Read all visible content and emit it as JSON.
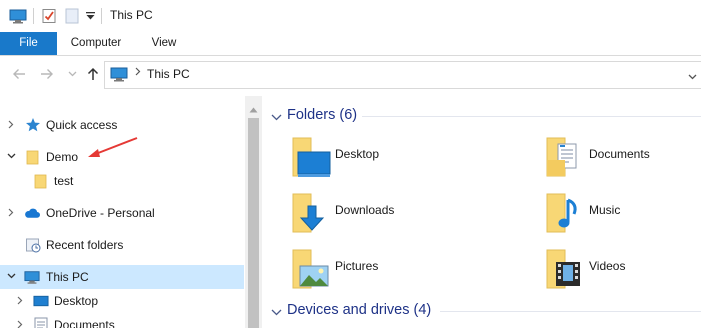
{
  "window": {
    "title": "This PC"
  },
  "ribbon": {
    "tabs": [
      {
        "label": "File"
      },
      {
        "label": "Computer"
      },
      {
        "label": "View"
      }
    ]
  },
  "address": {
    "path": "This PC"
  },
  "nav": {
    "items": [
      {
        "label": "Quick access",
        "icon": "star-pin-icon"
      },
      {
        "label": "Demo",
        "icon": "folder-icon",
        "expanded": true
      },
      {
        "label": "test",
        "icon": "folder-icon"
      },
      {
        "label": "OneDrive - Personal",
        "icon": "cloud-icon"
      },
      {
        "label": "Recent folders",
        "icon": "recent-folders-icon"
      },
      {
        "label": "This PC",
        "icon": "pc-icon",
        "selected": true
      },
      {
        "label": "Desktop",
        "icon": "desktop-folder-icon"
      },
      {
        "label": "Documents",
        "icon": "documents-folder-icon"
      }
    ]
  },
  "content": {
    "folders_header": "Folders (6)",
    "folders": [
      {
        "label": "Desktop",
        "icon": "desktop-folder-icon"
      },
      {
        "label": "Documents",
        "icon": "documents-folder-icon"
      },
      {
        "label": "Downloads",
        "icon": "downloads-folder-icon"
      },
      {
        "label": "Music",
        "icon": "music-folder-icon"
      },
      {
        "label": "Pictures",
        "icon": "pictures-folder-icon"
      },
      {
        "label": "Videos",
        "icon": "videos-folder-icon"
      }
    ],
    "devices_header": "Devices and drives (4)"
  },
  "colors": {
    "accent": "#1979ca",
    "selection": "#cce8ff",
    "group_title": "#1e3287",
    "annotation": "#e53935",
    "folder": "#f8d775"
  }
}
